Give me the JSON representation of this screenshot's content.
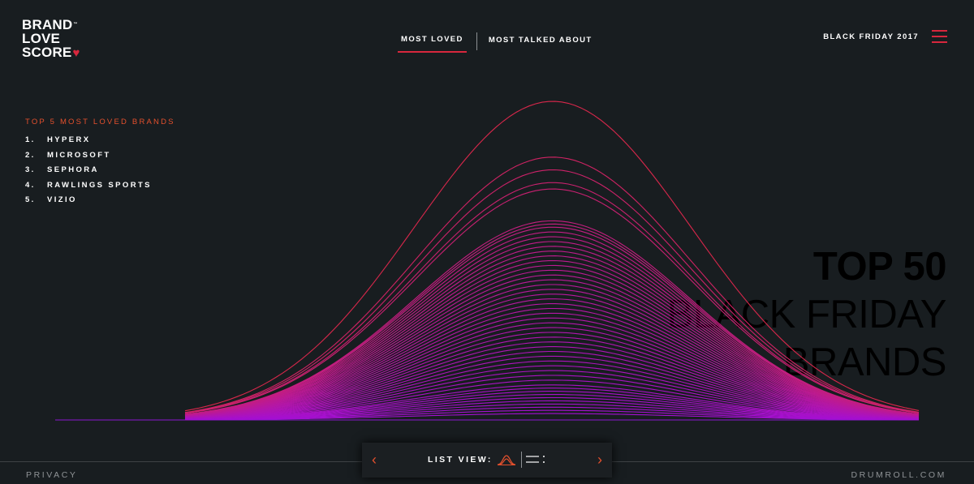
{
  "logo": {
    "line1": "BRAND",
    "line2": "LOVE",
    "line3": "SCORE",
    "tm": "™",
    "heart": "♥"
  },
  "nav": {
    "tabs": [
      {
        "label": "MOST LOVED",
        "active": true
      },
      {
        "label": "MOST TALKED ABOUT",
        "active": false
      }
    ]
  },
  "header": {
    "event": "BLACK FRIDAY 2017",
    "menu_icon": "hamburger-icon"
  },
  "top_list": {
    "heading": "TOP 5 MOST LOVED BRANDS",
    "items": [
      {
        "num": "1.",
        "name": "HYPERX"
      },
      {
        "num": "2.",
        "name": "MICROSOFT"
      },
      {
        "num": "3.",
        "name": "SEPHORA"
      },
      {
        "num": "4.",
        "name": "RAWLINGS SPORTS"
      },
      {
        "num": "5.",
        "name": "VIZIO"
      }
    ]
  },
  "hero": {
    "line1": "TOP 50",
    "line2": "BLACK FRIDAY",
    "line3": "BRANDS"
  },
  "list_view": {
    "label": "LIST VIEW:",
    "prev_icon": "chevron-left-icon",
    "next_icon": "chevron-right-icon"
  },
  "footer": {
    "privacy": "PRIVACY",
    "site": "DRUMROLL.COM"
  },
  "colors": {
    "background": "#181d20",
    "accent": "#d8273d",
    "accent_orange": "#e4502d",
    "curve_high": "#d8274b",
    "curve_low": "#a30fd5"
  },
  "chart_data": {
    "type": "area",
    "series_count": 50,
    "relative_scores": [
      1.0,
      0.825,
      0.785,
      0.745,
      0.725,
      0.625,
      0.615,
      0.605,
      0.59,
      0.575,
      0.56,
      0.545,
      0.53,
      0.515,
      0.5,
      0.485,
      0.47,
      0.455,
      0.44,
      0.425,
      0.41,
      0.395,
      0.38,
      0.365,
      0.35,
      0.335,
      0.32,
      0.305,
      0.29,
      0.275,
      0.26,
      0.245,
      0.23,
      0.215,
      0.2,
      0.185,
      0.17,
      0.155,
      0.14,
      0.125,
      0.11,
      0.1,
      0.09,
      0.08,
      0.07,
      0.06,
      0.05,
      0.04,
      0.03,
      0.02
    ]
  }
}
